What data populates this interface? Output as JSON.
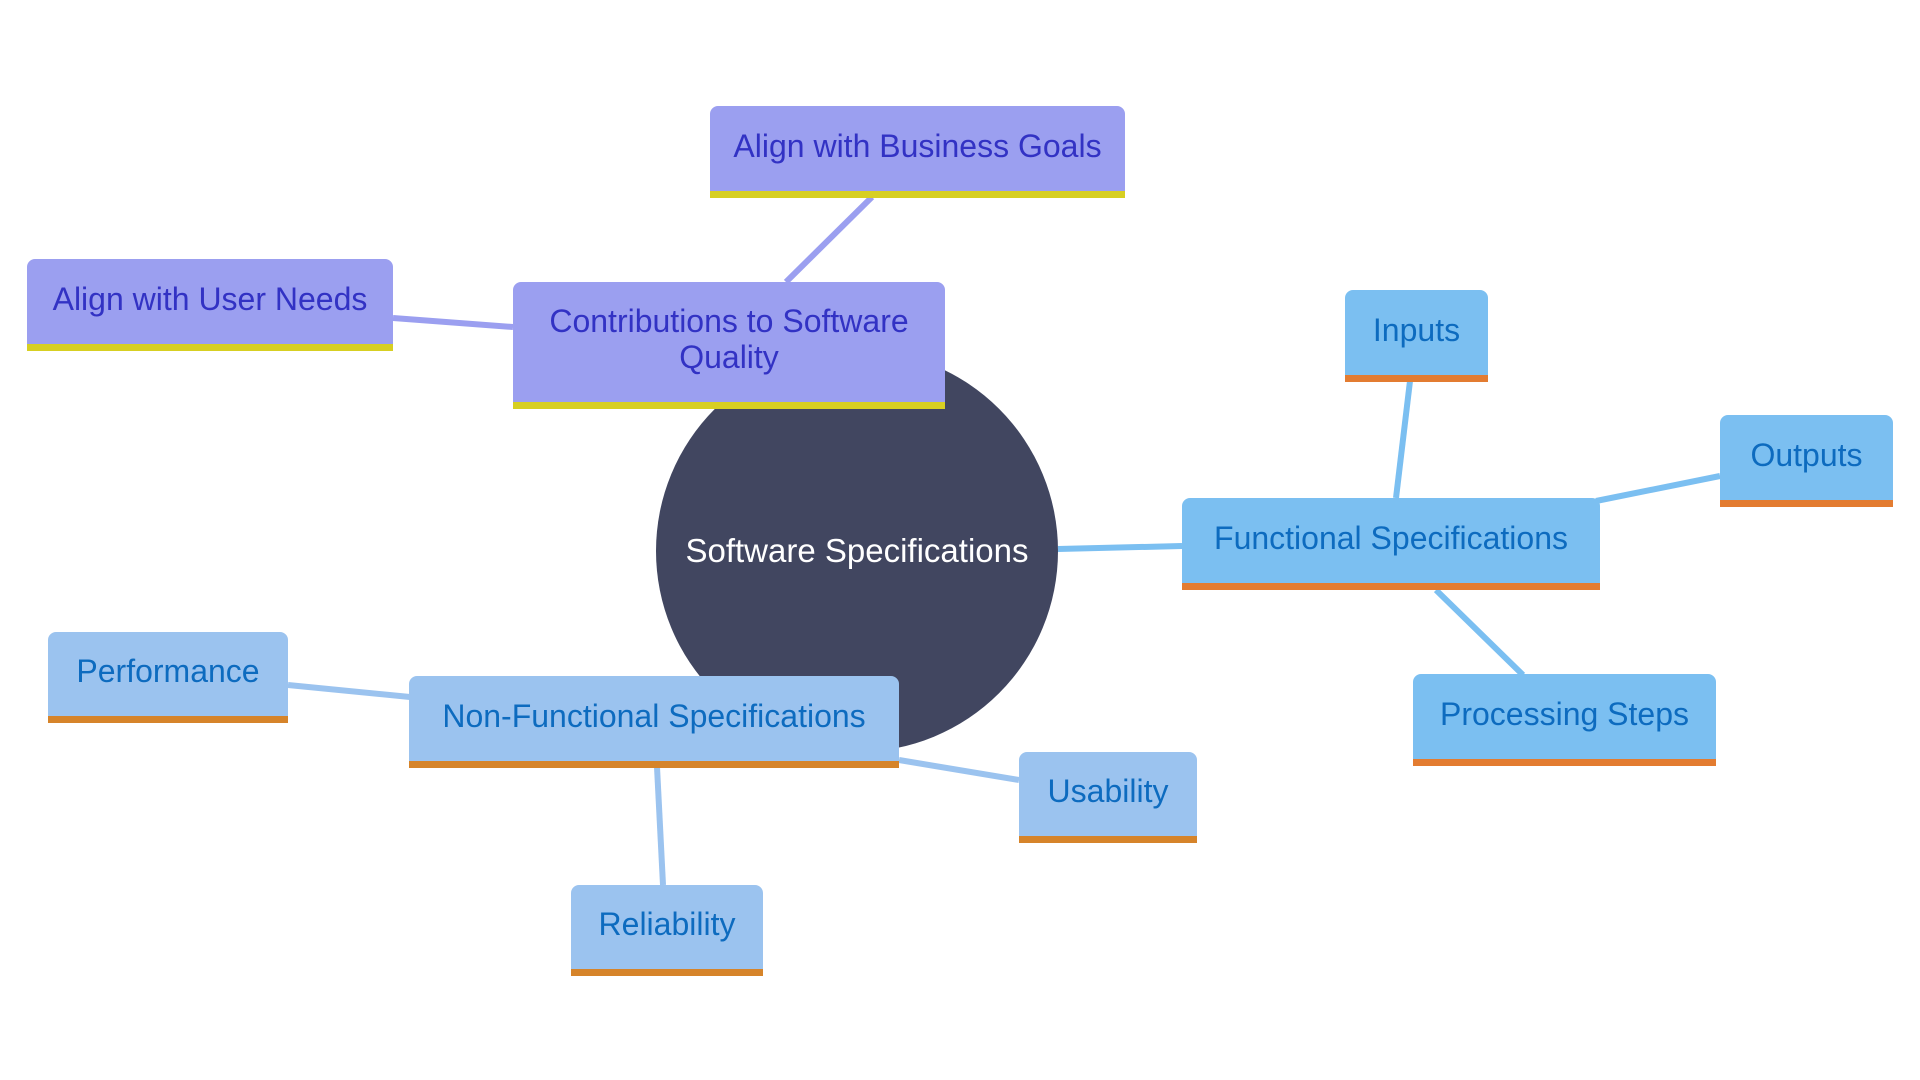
{
  "diagram": {
    "type": "mind-map",
    "root": {
      "label": "Software Specifications"
    },
    "branches": [
      {
        "label": "Contributions to Software Quality",
        "children": [
          "Align with Business Goals",
          "Align with User Needs"
        ]
      },
      {
        "label": "Functional Specifications",
        "children": [
          "Inputs",
          "Outputs",
          "Processing Steps"
        ]
      },
      {
        "label": "Non-Functional Specifications",
        "children": [
          "Performance",
          "Usability",
          "Reliability"
        ]
      }
    ]
  },
  "colors": {
    "root_fill": "#414660",
    "quality_fill": "#9b9ff0",
    "quality_text": "#3232c4",
    "quality_accent": "#d7cf22",
    "functional_fill": "#7bbff1",
    "functional_accent": "#e37c31",
    "nonfunctional_fill": "#9bc3ef",
    "nonfunctional_accent": "#d6842a",
    "node_text_blue": "#0d6bbf"
  }
}
